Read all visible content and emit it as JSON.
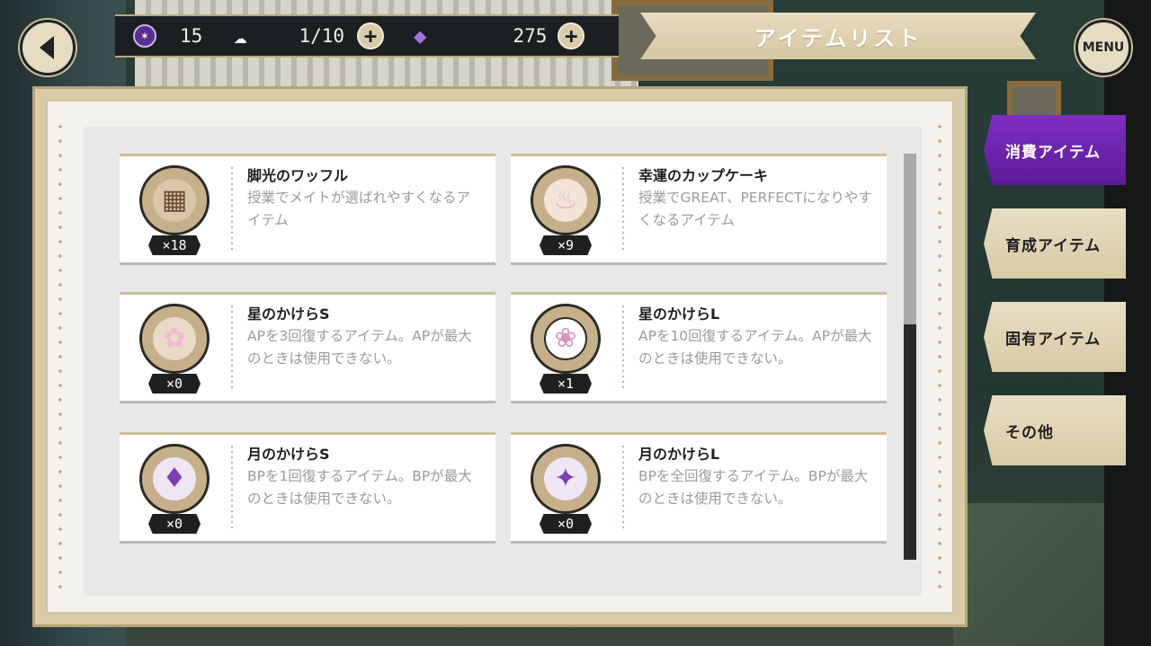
{
  "header": {
    "title": "アイテムリスト",
    "menu_label": "MENU",
    "stats": {
      "gem_count": "15",
      "ap_value": "1/10",
      "crystal_count": "275"
    }
  },
  "tabs": [
    {
      "label": "消費アイテム",
      "active": true
    },
    {
      "label": "育成アイテム",
      "active": false
    },
    {
      "label": "固有アイテム",
      "active": false
    },
    {
      "label": "その他",
      "active": false
    }
  ],
  "items": [
    {
      "name": "脚光のワッフル",
      "desc": "授業でメイトが選ばれやすくなるアイテム",
      "count": "×18",
      "icon": "waffle-icon",
      "glyph": "▦",
      "color": "#6b4a36"
    },
    {
      "name": "幸運のカップケーキ",
      "desc": "授業でGREAT、PERFECTになりやすくなるアイテム",
      "count": "×9",
      "icon": "cupcake-icon",
      "glyph": "♨",
      "color": "#e7b5b5"
    },
    {
      "name": "星のかけらS",
      "desc": "APを3回復するアイテム。APが最大のときは使用できない。",
      "count": "×0",
      "icon": "star-fragment-small-icon",
      "glyph": "✿",
      "color": "#f0b9d6"
    },
    {
      "name": "星のかけらL",
      "desc": "APを10回復するアイテム。APが最大のときは使用できない。",
      "count": "×1",
      "icon": "star-fragment-jar-icon",
      "glyph": "❀",
      "color": "#f0b9d6"
    },
    {
      "name": "月のかけらS",
      "desc": "BPを1回復するアイテム。BPが最大のときは使用できない。",
      "count": "×0",
      "icon": "moon-fragment-small-icon",
      "glyph": "♦",
      "color": "#7a3fb0"
    },
    {
      "name": "月のかけらL",
      "desc": "BPを全回復するアイテム。BPが最大のときは使用できない。",
      "count": "×0",
      "icon": "moon-fragment-vase-icon",
      "glyph": "✦",
      "color": "#7a3fb0"
    }
  ]
}
